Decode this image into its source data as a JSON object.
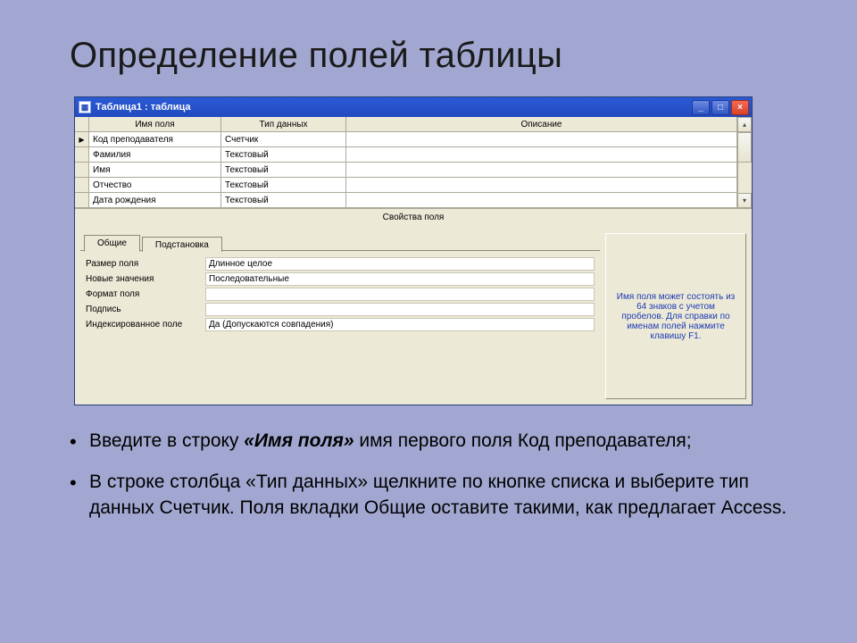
{
  "slide_title": "Определение полей таблицы",
  "window": {
    "title": "Таблица1 : таблица",
    "columns": {
      "selector": "",
      "name": "Имя поля",
      "type": "Тип данных",
      "desc": "Описание"
    },
    "rows": [
      {
        "name": "Код преподавателя",
        "type": "Счетчик",
        "desc": "",
        "selected": true
      },
      {
        "name": "Фамилия",
        "type": "Текстовый",
        "desc": "",
        "selected": false
      },
      {
        "name": "Имя",
        "type": "Текстовый",
        "desc": "",
        "selected": false
      },
      {
        "name": "Отчество",
        "type": "Текстовый",
        "desc": "",
        "selected": false
      },
      {
        "name": "Дата рождения",
        "type": "Текстовый",
        "desc": "",
        "selected": false
      }
    ],
    "props_title": "Свойства поля",
    "tabs": {
      "general": "Общие",
      "lookup": "Подстановка"
    },
    "props": [
      {
        "label": "Размер поля",
        "value": "Длинное целое"
      },
      {
        "label": "Новые значения",
        "value": "Последовательные"
      },
      {
        "label": "Формат поля",
        "value": ""
      },
      {
        "label": "Подпись",
        "value": ""
      },
      {
        "label": "Индексированное поле",
        "value": "Да (Допускаются совпадения)"
      }
    ],
    "help_text": "Имя поля может состоять из 64 знаков с учетом пробелов.  Для справки по именам полей нажмите клавишу F1."
  },
  "bullets": {
    "b1a": "Введите в строку ",
    "b1b": "«Имя поля»",
    "b1c": " имя первого поля Код преподавателя;",
    "b2": "В строке столбца «Тип данных» щелкните по кнопке списка и выберите тип данных Счетчик. Поля вкладки Общие оставите такими, как предлагает Access."
  }
}
